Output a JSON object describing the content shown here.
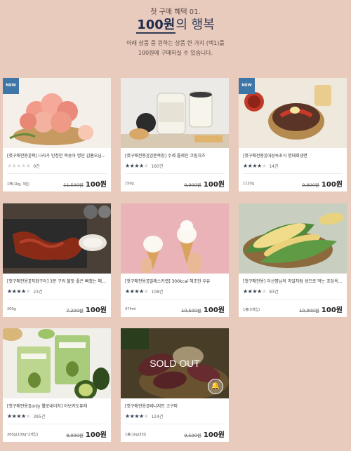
{
  "header": {
    "kicker": "첫 구매 혜택 01.",
    "title_highlight": "100원",
    "title_rest": "의 행복",
    "desc_line1": "아래 상품 중 원하는 상품 한 가지 (택1)를",
    "desc_line2": "100원에 구매하실 수 있습니다."
  },
  "cards": [
    {
      "badge": "NEW",
      "name": "[첫구매전용][팩] 나라가 인정한 복숭아 명인 김홍오님...",
      "stars": 0,
      "reviews": "0건",
      "meta": "1팩(1kg, 3입)",
      "orig_price": "11,500원",
      "sale_price": "100원",
      "sold_out": false
    },
    {
      "badge": "",
      "name": "[첫구매전용][엄준목장] 수제 플레인 크림치즈",
      "stars": 4.5,
      "reviews": "160건",
      "meta": "150g",
      "orig_price": "9,900원",
      "sale_price": "100원",
      "sold_out": false
    },
    {
      "badge": "NEW",
      "name": "[첫구매전용][대성속초식 명태회냉면",
      "stars": 4.5,
      "reviews": "14건",
      "meta": "1120g",
      "orig_price": "9,800원",
      "sale_price": "100원",
      "sold_out": false
    },
    {
      "badge": "",
      "name": "[첫구매전용][직화구이] 3분 구워 불맛 좋은 빠졌는 매운...",
      "stars": 4.5,
      "reviews": "23건",
      "meta": "200g",
      "orig_price": "7,200원",
      "sale_price": "100원",
      "sold_out": false
    },
    {
      "badge": "",
      "name": "[첫구매전용][밀레스카랩] 300kcal 헤조한 우유",
      "stars": 4.5,
      "reviews": "108건",
      "meta": "474ml",
      "orig_price": "10,500원",
      "sale_price": "100원",
      "sold_out": false
    },
    {
      "badge": "",
      "name": "[첫구매전용] 이산명님의 과일처럼 생으로 먹는 초당옥...",
      "stars": 4.5,
      "reviews": "83건",
      "meta": "1봉(5개입)",
      "orig_price": "10,900원",
      "sale_price": "100원",
      "sold_out": false
    },
    {
      "badge": "",
      "name": "[첫구매전용][only 웰로네이처] 아보카도퓨레",
      "stars": 4.5,
      "reviews": "395건",
      "meta": "200g(100g*2개입)",
      "orig_price": "8,900원",
      "sale_price": "100원",
      "sold_out": false
    },
    {
      "badge": "",
      "name": "[첫구매전용][베니지민 고구마",
      "stars": 4.5,
      "reviews": "124건",
      "meta": "1봉(1kg내외)",
      "orig_price": "9,500원",
      "sale_price": "100원",
      "sold_out": true,
      "sold_out_label": "SOLD OUT"
    }
  ],
  "colors": {
    "background": "#e9cbbd",
    "title": "#2f3a55",
    "badge": "#3f76a8"
  },
  "icons": [
    "bell-icon",
    "star-icon"
  ]
}
